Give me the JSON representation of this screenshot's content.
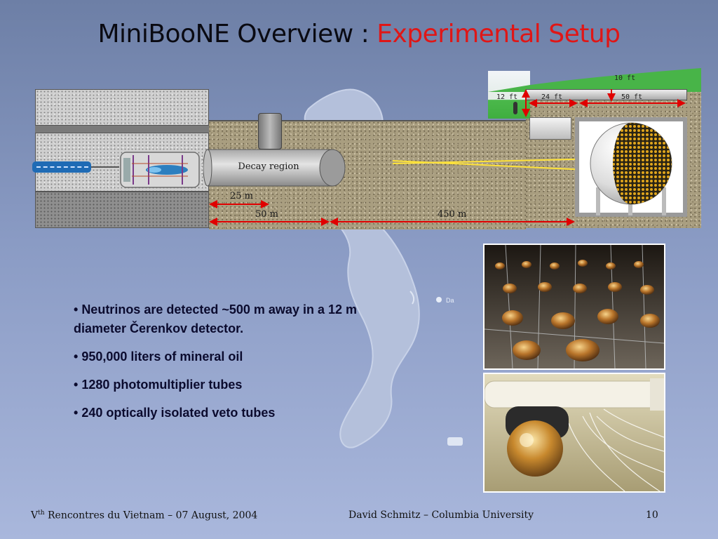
{
  "slide": {
    "title_main": "MiniBooNE Overview : ",
    "title_accent": "Experimental Setup"
  },
  "diagram": {
    "decay_region_label": "Decay region",
    "dim_25m": "25 m",
    "dim_50m": "50 m",
    "dim_450m": "450 m",
    "dim_10ft": "10 ft",
    "dim_12ft": "12 ft",
    "dim_24ft": "24 ft",
    "dim_50ft": "50 ft"
  },
  "map": {
    "label_da": "Da"
  },
  "bullets": [
    "Neutrinos are detected ~500 m away in a 12 m diameter Čerenkov detector.",
    "950,000 liters of mineral oil",
    "1280 photomultiplier tubes",
    "240 optically isolated veto tubes"
  ],
  "footer": {
    "left_prefix": "V",
    "left_sup": "th",
    "left_suffix": " Rencontres du Vietnam – 07 August, 2004",
    "center": "David Schmitz – Columbia University",
    "page": "10"
  },
  "colors": {
    "title_accent": "#e01616",
    "dimension_arrow": "#e00000",
    "background_top": "#6d7fa6",
    "background_bottom": "#a9b7dc"
  }
}
